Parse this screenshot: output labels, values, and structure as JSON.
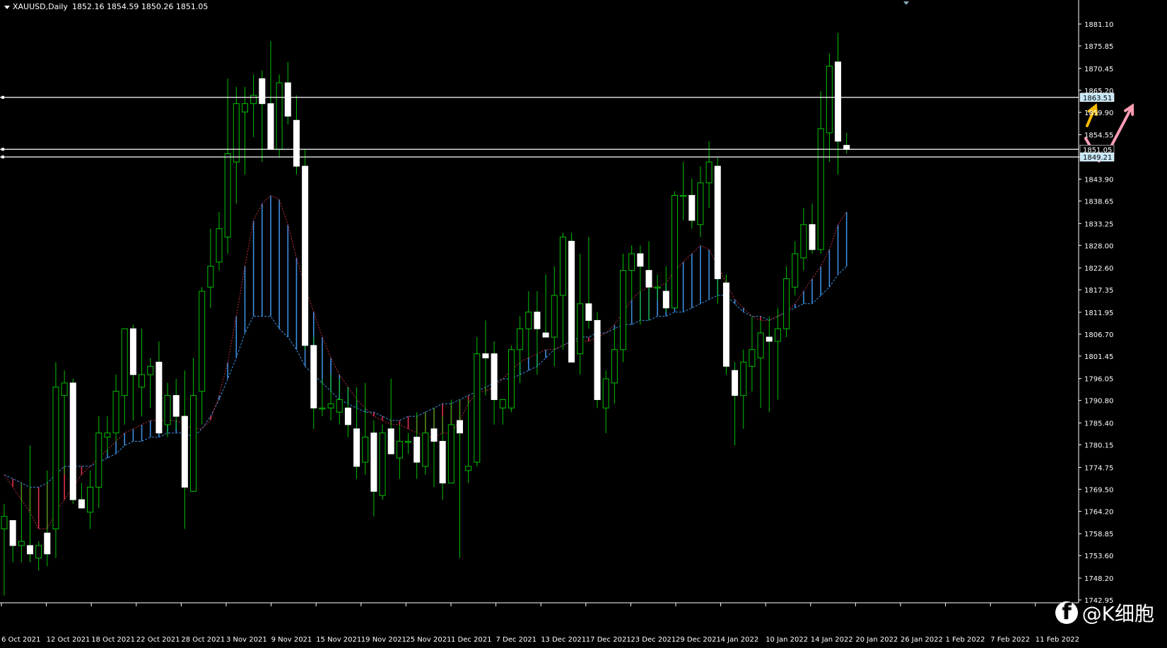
{
  "header": {
    "symbol": "XAUUSD,Daily",
    "ohlc": "1852.16 1854.59 1850.26 1851.05"
  },
  "watermark": {
    "icon": "facebook-icon",
    "text": "@K细胞"
  },
  "colors": {
    "background": "#000000",
    "bull_candle_body": "#000000",
    "bear_candle_body": "#ffffff",
    "candle_wick": "#00c000",
    "hline": "#ffffff",
    "cloud_blue": "#3d8fe0",
    "cloud_red": "#e0304e",
    "ma_blue": "#3d8fe0",
    "ma_red": "#c0303e",
    "arrow_yellow": "#f5b800",
    "arrow_pink": "#ff9db5",
    "price_label_bg": "#c8e8f8"
  },
  "price_axis": {
    "ticks": [
      "1881.10",
      "1875.85",
      "1870.45",
      "1865.20",
      "1859.90",
      "1854.55",
      "1849.20",
      "1843.90",
      "1838.65",
      "1833.25",
      "1828.00",
      "1822.60",
      "1817.35",
      "1811.95",
      "1806.70",
      "1801.45",
      "1796.05",
      "1790.80",
      "1785.40",
      "1780.15",
      "1774.75",
      "1769.50",
      "1764.20",
      "1758.85",
      "1753.60",
      "1748.20",
      "1742.95"
    ],
    "labels": [
      {
        "text": "1863.51",
        "value": 1863.51,
        "highlight": true
      },
      {
        "text": "1851.05",
        "value": 1851.05,
        "highlight": false
      },
      {
        "text": "1849.21",
        "value": 1849.21,
        "highlight": true
      }
    ]
  },
  "date_axis": {
    "ticks": [
      "6 Oct 2021",
      "12 Oct 2021",
      "18 Oct 2021",
      "22 Oct 2021",
      "28 Oct 2021",
      "3 Nov 2021",
      "9 Nov 2021",
      "15 Nov 2021",
      "19 Nov 2021",
      "25 Nov 2021",
      "1 Dec 2021",
      "7 Dec 2021",
      "13 Dec 2021",
      "17 Dec 2021",
      "23 Dec 2021",
      "29 Dec 2021",
      "4 Jan 2022",
      "10 Jan 2022",
      "14 Jan 2022",
      "20 Jan 2022",
      "26 Jan 2022",
      "1 Feb 2022",
      "7 Feb 2022",
      "11 Feb 2022"
    ]
  },
  "chart_data": {
    "type": "candlestick",
    "symbol": "XAUUSD",
    "timeframe": "Daily",
    "ylim": [
      1742.95,
      1881.1
    ],
    "horizontal_lines": [
      1863.51,
      1851.05,
      1849.21
    ],
    "candles": [
      {
        "o": 1760,
        "h": 1766,
        "l": 1744,
        "c": 1763
      },
      {
        "o": 1762,
        "h": 1762,
        "l": 1752,
        "c": 1756
      },
      {
        "o": 1756,
        "h": 1771,
        "l": 1752,
        "c": 1757
      },
      {
        "o": 1756,
        "h": 1780,
        "l": 1752,
        "c": 1754
      },
      {
        "o": 1753,
        "h": 1757,
        "l": 1750,
        "c": 1756
      },
      {
        "o": 1759,
        "h": 1774,
        "l": 1751,
        "c": 1754
      },
      {
        "o": 1760,
        "h": 1800,
        "l": 1753,
        "c": 1794
      },
      {
        "o": 1792,
        "h": 1798,
        "l": 1773,
        "c": 1795
      },
      {
        "o": 1795,
        "h": 1796,
        "l": 1766,
        "c": 1767
      },
      {
        "o": 1767,
        "h": 1771,
        "l": 1765,
        "c": 1765
      },
      {
        "o": 1764,
        "h": 1774,
        "l": 1760,
        "c": 1770
      },
      {
        "o": 1770,
        "h": 1787,
        "l": 1765,
        "c": 1783
      },
      {
        "o": 1782,
        "h": 1787,
        "l": 1778,
        "c": 1783
      },
      {
        "o": 1783,
        "h": 1797,
        "l": 1781,
        "c": 1793
      },
      {
        "o": 1792,
        "h": 1808,
        "l": 1785,
        "c": 1808
      },
      {
        "o": 1808,
        "h": 1809,
        "l": 1786,
        "c": 1797
      },
      {
        "o": 1794,
        "h": 1808,
        "l": 1787,
        "c": 1797
      },
      {
        "o": 1797,
        "h": 1801,
        "l": 1789,
        "c": 1799
      },
      {
        "o": 1800,
        "h": 1805,
        "l": 1783,
        "c": 1783
      },
      {
        "o": 1785,
        "h": 1795,
        "l": 1782,
        "c": 1792
      },
      {
        "o": 1792,
        "h": 1796,
        "l": 1784,
        "c": 1787
      },
      {
        "o": 1787,
        "h": 1798,
        "l": 1760,
        "c": 1770
      },
      {
        "o": 1769,
        "h": 1801,
        "l": 1769,
        "c": 1792
      },
      {
        "o": 1793,
        "h": 1818,
        "l": 1785,
        "c": 1817
      },
      {
        "o": 1818,
        "h": 1832,
        "l": 1813,
        "c": 1823
      },
      {
        "o": 1824,
        "h": 1836,
        "l": 1822,
        "c": 1832
      },
      {
        "o": 1830,
        "h": 1868,
        "l": 1826,
        "c": 1850
      },
      {
        "o": 1848,
        "h": 1866,
        "l": 1838,
        "c": 1862
      },
      {
        "o": 1860,
        "h": 1866,
        "l": 1845,
        "c": 1862
      },
      {
        "o": 1862,
        "h": 1869,
        "l": 1854,
        "c": 1864
      },
      {
        "o": 1868,
        "h": 1870,
        "l": 1848,
        "c": 1862
      },
      {
        "o": 1862,
        "h": 1877,
        "l": 1851,
        "c": 1851
      },
      {
        "o": 1851,
        "h": 1869,
        "l": 1849,
        "c": 1867
      },
      {
        "o": 1867,
        "h": 1872,
        "l": 1857,
        "c": 1859
      },
      {
        "o": 1858,
        "h": 1864,
        "l": 1845,
        "c": 1847
      },
      {
        "o": 1847,
        "h": 1851,
        "l": 1803,
        "c": 1804
      },
      {
        "o": 1804,
        "h": 1806,
        "l": 1784,
        "c": 1789
      },
      {
        "o": 1789,
        "h": 1796,
        "l": 1787,
        "c": 1789
      },
      {
        "o": 1789,
        "h": 1797,
        "l": 1786,
        "c": 1790
      },
      {
        "o": 1788,
        "h": 1796,
        "l": 1785,
        "c": 1791
      },
      {
        "o": 1789,
        "h": 1794,
        "l": 1782,
        "c": 1785
      },
      {
        "o": 1784,
        "h": 1794,
        "l": 1772,
        "c": 1775
      },
      {
        "o": 1776,
        "h": 1795,
        "l": 1773,
        "c": 1782
      },
      {
        "o": 1783,
        "h": 1786,
        "l": 1763,
        "c": 1769
      },
      {
        "o": 1768,
        "h": 1785,
        "l": 1767,
        "c": 1783
      },
      {
        "o": 1784,
        "h": 1796,
        "l": 1778,
        "c": 1778
      },
      {
        "o": 1777,
        "h": 1785,
        "l": 1772,
        "c": 1781
      },
      {
        "o": 1781,
        "h": 1783,
        "l": 1778,
        "c": 1781
      },
      {
        "o": 1782,
        "h": 1788,
        "l": 1772,
        "c": 1776
      },
      {
        "o": 1775,
        "h": 1788,
        "l": 1773,
        "c": 1783
      },
      {
        "o": 1784,
        "h": 1789,
        "l": 1770,
        "c": 1781
      },
      {
        "o": 1781,
        "h": 1787,
        "l": 1767,
        "c": 1771
      },
      {
        "o": 1771,
        "h": 1791,
        "l": 1771,
        "c": 1785
      },
      {
        "o": 1786,
        "h": 1791,
        "l": 1753,
        "c": 1783
      },
      {
        "o": 1774,
        "h": 1791,
        "l": 1771,
        "c": 1775
      },
      {
        "o": 1776,
        "h": 1806,
        "l": 1775,
        "c": 1802
      },
      {
        "o": 1802,
        "h": 1810,
        "l": 1792,
        "c": 1801
      },
      {
        "o": 1802,
        "h": 1805,
        "l": 1785,
        "c": 1791
      },
      {
        "o": 1789,
        "h": 1791,
        "l": 1785,
        "c": 1791
      },
      {
        "o": 1789,
        "h": 1804,
        "l": 1788,
        "c": 1803
      },
      {
        "o": 1803,
        "h": 1811,
        "l": 1795,
        "c": 1808
      },
      {
        "o": 1808,
        "h": 1817,
        "l": 1801,
        "c": 1812
      },
      {
        "o": 1812,
        "h": 1817,
        "l": 1797,
        "c": 1808
      },
      {
        "o": 1807,
        "h": 1821,
        "l": 1806,
        "c": 1806
      },
      {
        "o": 1806,
        "h": 1823,
        "l": 1799,
        "c": 1816
      },
      {
        "o": 1816,
        "h": 1831,
        "l": 1803,
        "c": 1830
      },
      {
        "o": 1829,
        "h": 1831,
        "l": 1801,
        "c": 1800
      },
      {
        "o": 1802,
        "h": 1826,
        "l": 1797,
        "c": 1814
      },
      {
        "o": 1814,
        "h": 1830,
        "l": 1808,
        "c": 1810
      },
      {
        "o": 1810,
        "h": 1812,
        "l": 1789,
        "c": 1791
      },
      {
        "o": 1789,
        "h": 1798,
        "l": 1783,
        "c": 1796
      },
      {
        "o": 1795,
        "h": 1808,
        "l": 1790,
        "c": 1803
      },
      {
        "o": 1803,
        "h": 1826,
        "l": 1800,
        "c": 1822
      },
      {
        "o": 1822,
        "h": 1828,
        "l": 1815,
        "c": 1826
      },
      {
        "o": 1826,
        "h": 1828,
        "l": 1809,
        "c": 1823
      },
      {
        "o": 1822,
        "h": 1829,
        "l": 1810,
        "c": 1818
      },
      {
        "o": 1818,
        "h": 1821,
        "l": 1815,
        "c": 1818
      },
      {
        "o": 1817,
        "h": 1823,
        "l": 1812,
        "c": 1813
      },
      {
        "o": 1813,
        "h": 1841,
        "l": 1813,
        "c": 1840
      },
      {
        "o": 1840,
        "h": 1848,
        "l": 1834,
        "c": 1840
      },
      {
        "o": 1840,
        "h": 1844,
        "l": 1832,
        "c": 1834
      },
      {
        "o": 1833,
        "h": 1847,
        "l": 1830,
        "c": 1843
      },
      {
        "o": 1843,
        "h": 1853,
        "l": 1837,
        "c": 1848
      },
      {
        "o": 1847,
        "h": 1849,
        "l": 1814,
        "c": 1820
      },
      {
        "o": 1819,
        "h": 1821,
        "l": 1797,
        "c": 1799
      },
      {
        "o": 1798,
        "h": 1800,
        "l": 1780,
        "c": 1792
      },
      {
        "o": 1792,
        "h": 1803,
        "l": 1784,
        "c": 1800
      },
      {
        "o": 1799,
        "h": 1811,
        "l": 1793,
        "c": 1803
      },
      {
        "o": 1801,
        "h": 1810,
        "l": 1789,
        "c": 1807
      },
      {
        "o": 1806,
        "h": 1811,
        "l": 1788,
        "c": 1805
      },
      {
        "o": 1805,
        "h": 1813,
        "l": 1791,
        "c": 1808
      },
      {
        "o": 1808,
        "h": 1823,
        "l": 1806,
        "c": 1820
      },
      {
        "o": 1818,
        "h": 1829,
        "l": 1816,
        "c": 1826
      },
      {
        "o": 1825,
        "h": 1837,
        "l": 1822,
        "c": 1833
      },
      {
        "o": 1833,
        "h": 1838,
        "l": 1826,
        "c": 1827
      },
      {
        "o": 1827,
        "h": 1865,
        "l": 1826,
        "c": 1856
      },
      {
        "o": 1855,
        "h": 1874,
        "l": 1848,
        "c": 1871
      },
      {
        "o": 1872,
        "h": 1879,
        "l": 1845,
        "c": 1853
      },
      {
        "o": 1852,
        "h": 1855,
        "l": 1850,
        "c": 1851
      }
    ],
    "ma_line": [
      1773,
      1772,
      1771,
      1770,
      1770,
      1771,
      1773,
      1775,
      1775,
      1775,
      1775,
      1776,
      1777,
      1778,
      1780,
      1781,
      1781,
      1782,
      1782,
      1783,
      1783,
      1783,
      1782,
      1784,
      1787,
      1791,
      1796,
      1801,
      1807,
      1811,
      1811,
      1811,
      1808,
      1806,
      1803,
      1799,
      1797,
      1795,
      1793,
      1791,
      1790,
      1789,
      1788,
      1788,
      1787,
      1786,
      1786,
      1787,
      1787,
      1788,
      1789,
      1790,
      1790,
      1791,
      1792,
      1793,
      1794,
      1795,
      1796,
      1796,
      1797,
      1798,
      1799,
      1801,
      1803,
      1804,
      1805,
      1806,
      1806,
      1807,
      1807,
      1808,
      1809,
      1809,
      1810,
      1810,
      1811,
      1811,
      1812,
      1812,
      1813,
      1814,
      1815,
      1816,
      1816,
      1814,
      1812,
      1811,
      1811,
      1810,
      1811,
      1812,
      1813,
      1814,
      1814,
      1816,
      1818,
      1821,
      1823
    ],
    "fast_line": [
      1773,
      1770,
      1767,
      1764,
      1760,
      1760,
      1764,
      1767,
      1770,
      1773,
      1775,
      1777,
      1779,
      1781,
      1783,
      1784,
      1785,
      1786,
      1786,
      1786,
      1786,
      1785,
      1784,
      1784,
      1786,
      1792,
      1800,
      1811,
      1823,
      1834,
      1838,
      1840,
      1839,
      1833,
      1825,
      1818,
      1812,
      1806,
      1801,
      1797,
      1794,
      1791,
      1789,
      1787,
      1786,
      1785,
      1785,
      1784,
      1783,
      1782,
      1782,
      1783,
      1783,
      1786,
      1790,
      1793,
      1793,
      1794,
      1796,
      1798,
      1800,
      1801,
      1802,
      1803,
      1803,
      1804,
      1805,
      1805,
      1805,
      1806,
      1807,
      1809,
      1812,
      1815,
      1817,
      1818,
      1818,
      1819,
      1822,
      1824,
      1826,
      1828,
      1827,
      1823,
      1819,
      1815,
      1813,
      1811,
      1810,
      1810,
      1811,
      1812,
      1814,
      1817,
      1820,
      1823,
      1827,
      1833,
      1836
    ]
  },
  "annotations": [
    {
      "type": "arrow",
      "color": "yellow",
      "direction": "up"
    },
    {
      "type": "arrow",
      "color": "pink",
      "direction": "down-then-up"
    }
  ]
}
